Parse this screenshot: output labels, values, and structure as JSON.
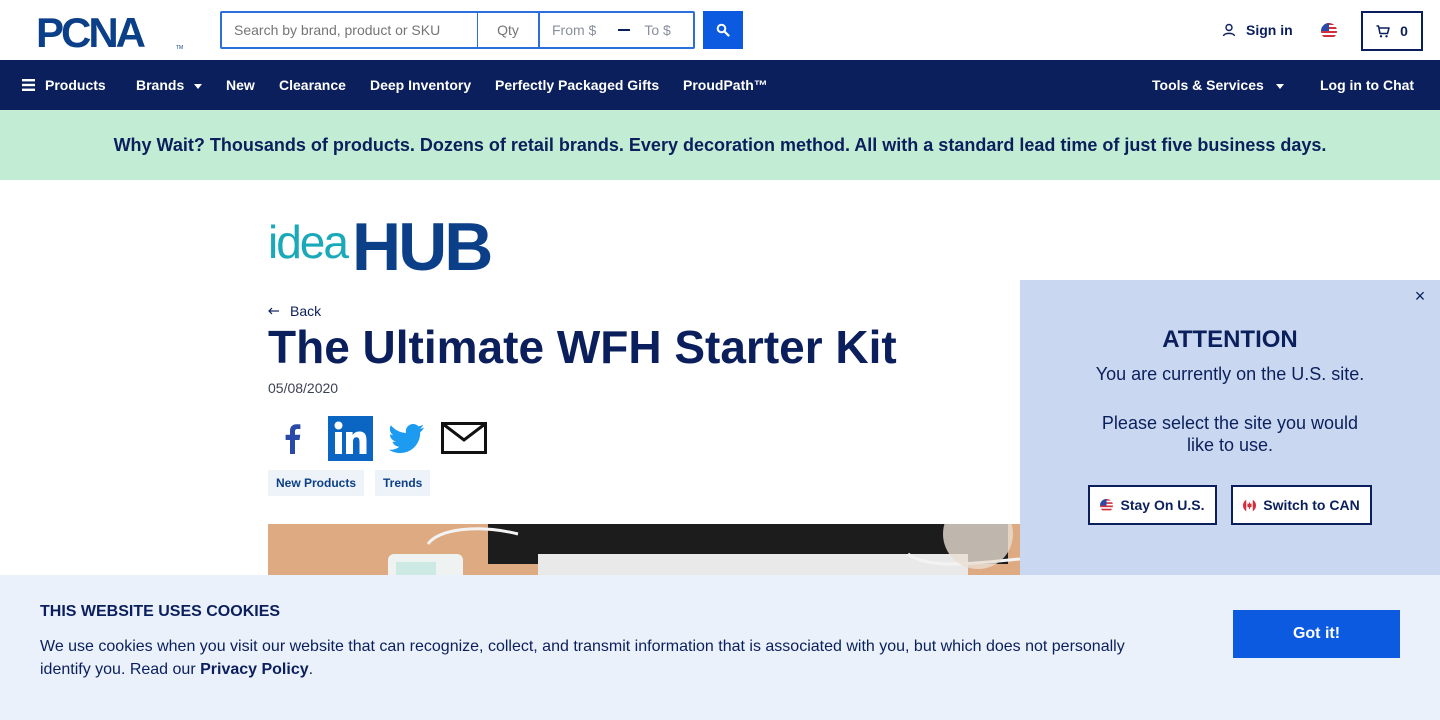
{
  "header": {
    "logo_text": "PCNA",
    "search_placeholder": "Search by brand, product or SKU",
    "qty_placeholder": "Qty",
    "price_from": "From $",
    "price_to": "To $",
    "sign_in": "Sign in",
    "cart_count": "0"
  },
  "nav": {
    "products": "Products",
    "brands": "Brands",
    "new": "New",
    "clearance": "Clearance",
    "deep_inventory": "Deep Inventory",
    "gifts": "Perfectly Packaged Gifts",
    "proudpath": "ProudPath™",
    "tools": "Tools & Services",
    "chat": "Log in to Chat"
  },
  "banner": {
    "text": "Why Wait? Thousands of products. Dozens of retail brands. Every decoration method. All with a standard lead time of just five business days."
  },
  "article": {
    "brand_logo": "ideaHUB",
    "back": "Back",
    "title": "The Ultimate WFH Starter Kit",
    "date": "05/08/2020",
    "tags": [
      "New Products",
      "Trends"
    ]
  },
  "region_modal": {
    "close": "×",
    "heading": "ATTENTION",
    "line1": "You are currently on the U.S. site.",
    "line2": "Please select the site you would like to use.",
    "stay_btn": "Stay On U.S.",
    "switch_btn": "Switch to CAN"
  },
  "cookie": {
    "title": "THIS WEBSITE USES COOKIES",
    "text": "We use cookies when you visit our website that can recognize, collect, and transmit information that is associated with you, but which does not personally identify you. Read our ",
    "link": "Privacy Policy",
    "period": ".",
    "button": "Got it!"
  },
  "colors": {
    "navy": "#0b1f5c",
    "primary_blue": "#0b5ae0",
    "banner_green": "#c3ecd4",
    "modal_bg": "#c9d8f0",
    "cookie_bg": "#eaf1fb",
    "ideahub_teal": "#1aa9b8",
    "ideahub_navy": "#0b3f87"
  }
}
